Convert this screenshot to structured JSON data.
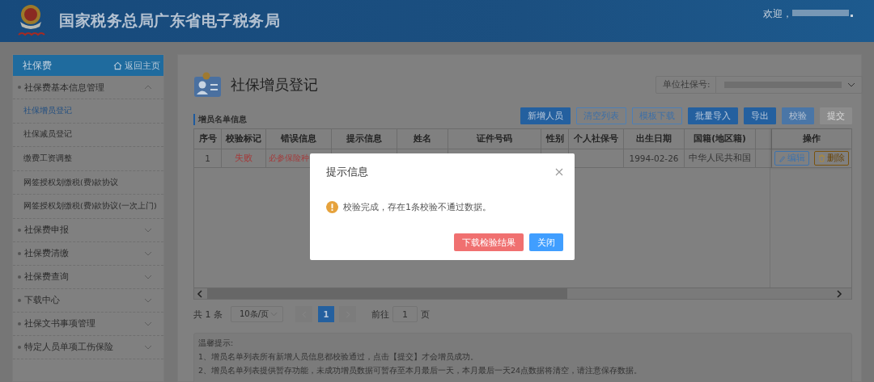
{
  "header": {
    "title": "国家税务总局广东省电子税务局",
    "welcome": "欢迎，"
  },
  "sidebar": {
    "title": "社保费",
    "home_link": "返回主页",
    "items": [
      {
        "label": "社保费基本信息管理",
        "expanded": true,
        "children": [
          {
            "label": "社保增员登记",
            "selected": true
          },
          {
            "label": "社保减员登记",
            "selected": false
          },
          {
            "label": "缴费工资调整",
            "selected": false
          },
          {
            "label": "网签授权划缴税(费)款协议",
            "selected": false
          },
          {
            "label": "网签授权划缴税(费)款协议(一次上门)",
            "selected": false
          }
        ]
      },
      {
        "label": "社保费申报",
        "expanded": false
      },
      {
        "label": "社保费清缴",
        "expanded": false
      },
      {
        "label": "社保费查询",
        "expanded": false
      },
      {
        "label": "下载中心",
        "expanded": false
      },
      {
        "label": "社保文书事项管理",
        "expanded": false
      },
      {
        "label": "特定人员单项工伤保险",
        "expanded": false
      }
    ]
  },
  "page": {
    "title": "社保增员登记",
    "unit_field": {
      "label": "单位社保号:"
    }
  },
  "toolbar": {
    "section_title": "增员名单信息",
    "buttons": [
      {
        "label": "新增人员",
        "kind": "primary",
        "disabled": false
      },
      {
        "label": "清空列表",
        "kind": "plain",
        "disabled": false
      },
      {
        "label": "模板下载",
        "kind": "plain",
        "disabled": false
      },
      {
        "label": "批量导入",
        "kind": "primary",
        "disabled": false
      },
      {
        "label": "导出",
        "kind": "primary",
        "disabled": false
      },
      {
        "label": "校验",
        "kind": "light",
        "disabled": false
      },
      {
        "label": "提交",
        "kind": "primary",
        "disabled": true
      }
    ]
  },
  "table": {
    "columns": [
      "序号",
      "校验标记",
      "错误信息",
      "提示信息",
      "姓名",
      "证件号码",
      "性别",
      "个人社保号",
      "出生日期",
      "国籍(地区籍)",
      "操作"
    ],
    "rows": [
      {
        "no": "1",
        "check_mark": "失败",
        "error_info": "必参保险种",
        "birth_date": "1994-02-26",
        "nationality": "中华人民共和国",
        "failed": true,
        "actions": [
          {
            "label": "编辑",
            "kind": "edit"
          },
          {
            "label": "删除",
            "kind": "delete"
          }
        ]
      }
    ]
  },
  "pagination": {
    "total": "共 1 条",
    "page_size": "10条/页",
    "pages": [
      {
        "label": "1",
        "selected": true
      }
    ],
    "goto_label": "前往",
    "goto_value": "1",
    "goto_suffix": "页"
  },
  "tips": {
    "title": "温馨提示:",
    "lines": [
      "1、增员名单列表所有新增人员信息都校验通过，点击【提交】才会增员成功。",
      "2、增员名单列表提供暂存功能，未成功增员数据可暂存至本月最后一天，本月最后一天24点数据将清空，请注意保存数据。"
    ]
  },
  "dialog": {
    "title": "提示信息",
    "message": "校验完成，存在1条校验不通过数据。",
    "buttons": [
      {
        "label": "下载检验结果",
        "kind": "danger"
      },
      {
        "label": "关闭",
        "kind": "primary"
      }
    ]
  }
}
